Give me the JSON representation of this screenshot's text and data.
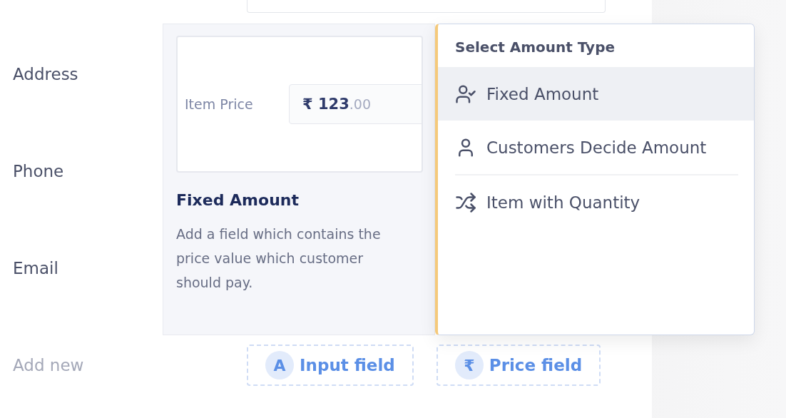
{
  "form": {
    "rows": [
      {
        "label": "Address"
      },
      {
        "label": "Phone"
      },
      {
        "label": "Email"
      }
    ],
    "add_new": {
      "label": "Add new",
      "buttons": [
        {
          "badge": "A",
          "label": "Input field"
        },
        {
          "badge": "₹",
          "label": "Price field"
        }
      ]
    }
  },
  "popover": {
    "preview": {
      "field_label": "Item Price",
      "value": "**₹ 123**.00",
      "title": "Fixed Amount",
      "description": "Add a field which contains the price value which customer should pay."
    },
    "menu": {
      "title": "Select Amount Type",
      "items": [
        {
          "kind": "user-check",
          "label": "Fixed Amount",
          "selected": true,
          "separated": false
        },
        {
          "kind": "user",
          "label": "Customers Decide Amount",
          "selected": false,
          "separated": false
        },
        {
          "kind": "shuffle",
          "label": "Item with Quantity",
          "selected": false,
          "separated": true
        }
      ]
    }
  }
}
